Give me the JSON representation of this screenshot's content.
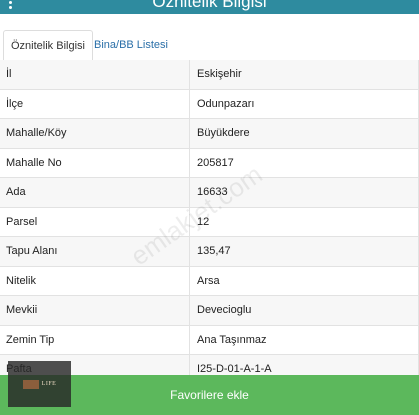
{
  "header": {
    "title": "Öznitelik Bilgisi"
  },
  "tabs": [
    {
      "label": "Öznitelik Bilgisi",
      "active": true
    },
    {
      "label": "Bina/BB Listesi",
      "active": false
    }
  ],
  "rows": [
    {
      "key": "İl",
      "value": "Eskişehir"
    },
    {
      "key": "İlçe",
      "value": "Odunpazarı"
    },
    {
      "key": "Mahalle/Köy",
      "value": "Büyükdere"
    },
    {
      "key": "Mahalle No",
      "value": "205817"
    },
    {
      "key": "Ada",
      "value": "16633"
    },
    {
      "key": "Parsel",
      "value": "12"
    },
    {
      "key": "Tapu Alanı",
      "value": "135,47"
    },
    {
      "key": "Nitelik",
      "value": "Arsa"
    },
    {
      "key": "Mevkii",
      "value": "Devecioglu"
    },
    {
      "key": "Zemin Tip",
      "value": "Ana Taşınmaz"
    },
    {
      "key": "Pafta",
      "value": "I25-D-01-A-1-A"
    }
  ],
  "watermark": "emlakjet.com",
  "logo": {
    "text": "LIFE"
  },
  "actions": {
    "favorite_label": "Favorilere ekle"
  },
  "colors": {
    "header": "#2e8b9f",
    "button": "#5cb85c",
    "tab_link": "#2a6fa8"
  }
}
